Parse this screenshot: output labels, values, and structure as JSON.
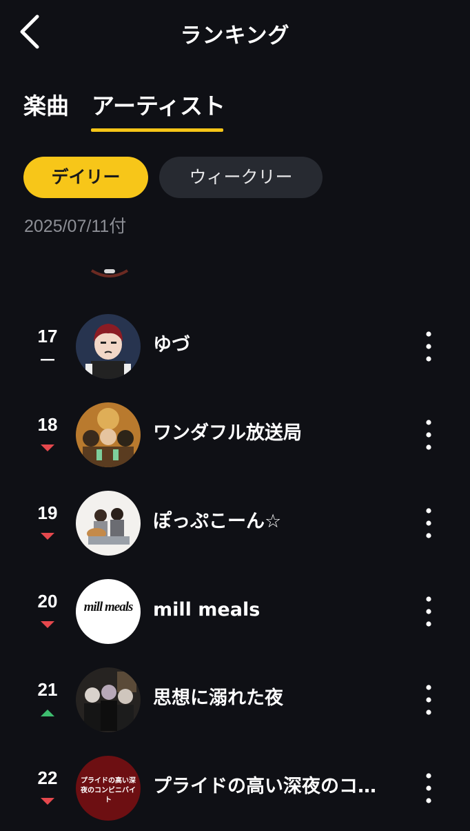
{
  "header": {
    "title": "ランキング",
    "back_icon": "chevron-left-icon"
  },
  "tabs": [
    {
      "label": "楽曲",
      "active": false
    },
    {
      "label": "アーティスト",
      "active": true
    }
  ],
  "period_filters": [
    {
      "label": "デイリー",
      "active": true
    },
    {
      "label": "ウィークリー",
      "active": false
    }
  ],
  "date_label": "2025/07/11付",
  "colors": {
    "background": "#0f1015",
    "accent": "#f5c518",
    "trend_down": "#e5484d",
    "trend_up": "#3ebd6f",
    "inactive_pill": "#272a31"
  },
  "ranking": [
    {
      "rank": "17",
      "trend": "same",
      "name": "ゆづ"
    },
    {
      "rank": "18",
      "trend": "down",
      "name": "ワンダフル放送局"
    },
    {
      "rank": "19",
      "trend": "down",
      "name": "ぽっぷこーん☆"
    },
    {
      "rank": "20",
      "trend": "down",
      "name": "mill meals",
      "avatar_text": "mill meals"
    },
    {
      "rank": "21",
      "trend": "up",
      "name": "思想に溺れた夜"
    },
    {
      "rank": "22",
      "trend": "down",
      "name": "プライドの高い深夜のコ…",
      "avatar_text": "プライドの高い深夜のコンビニバイト"
    }
  ]
}
